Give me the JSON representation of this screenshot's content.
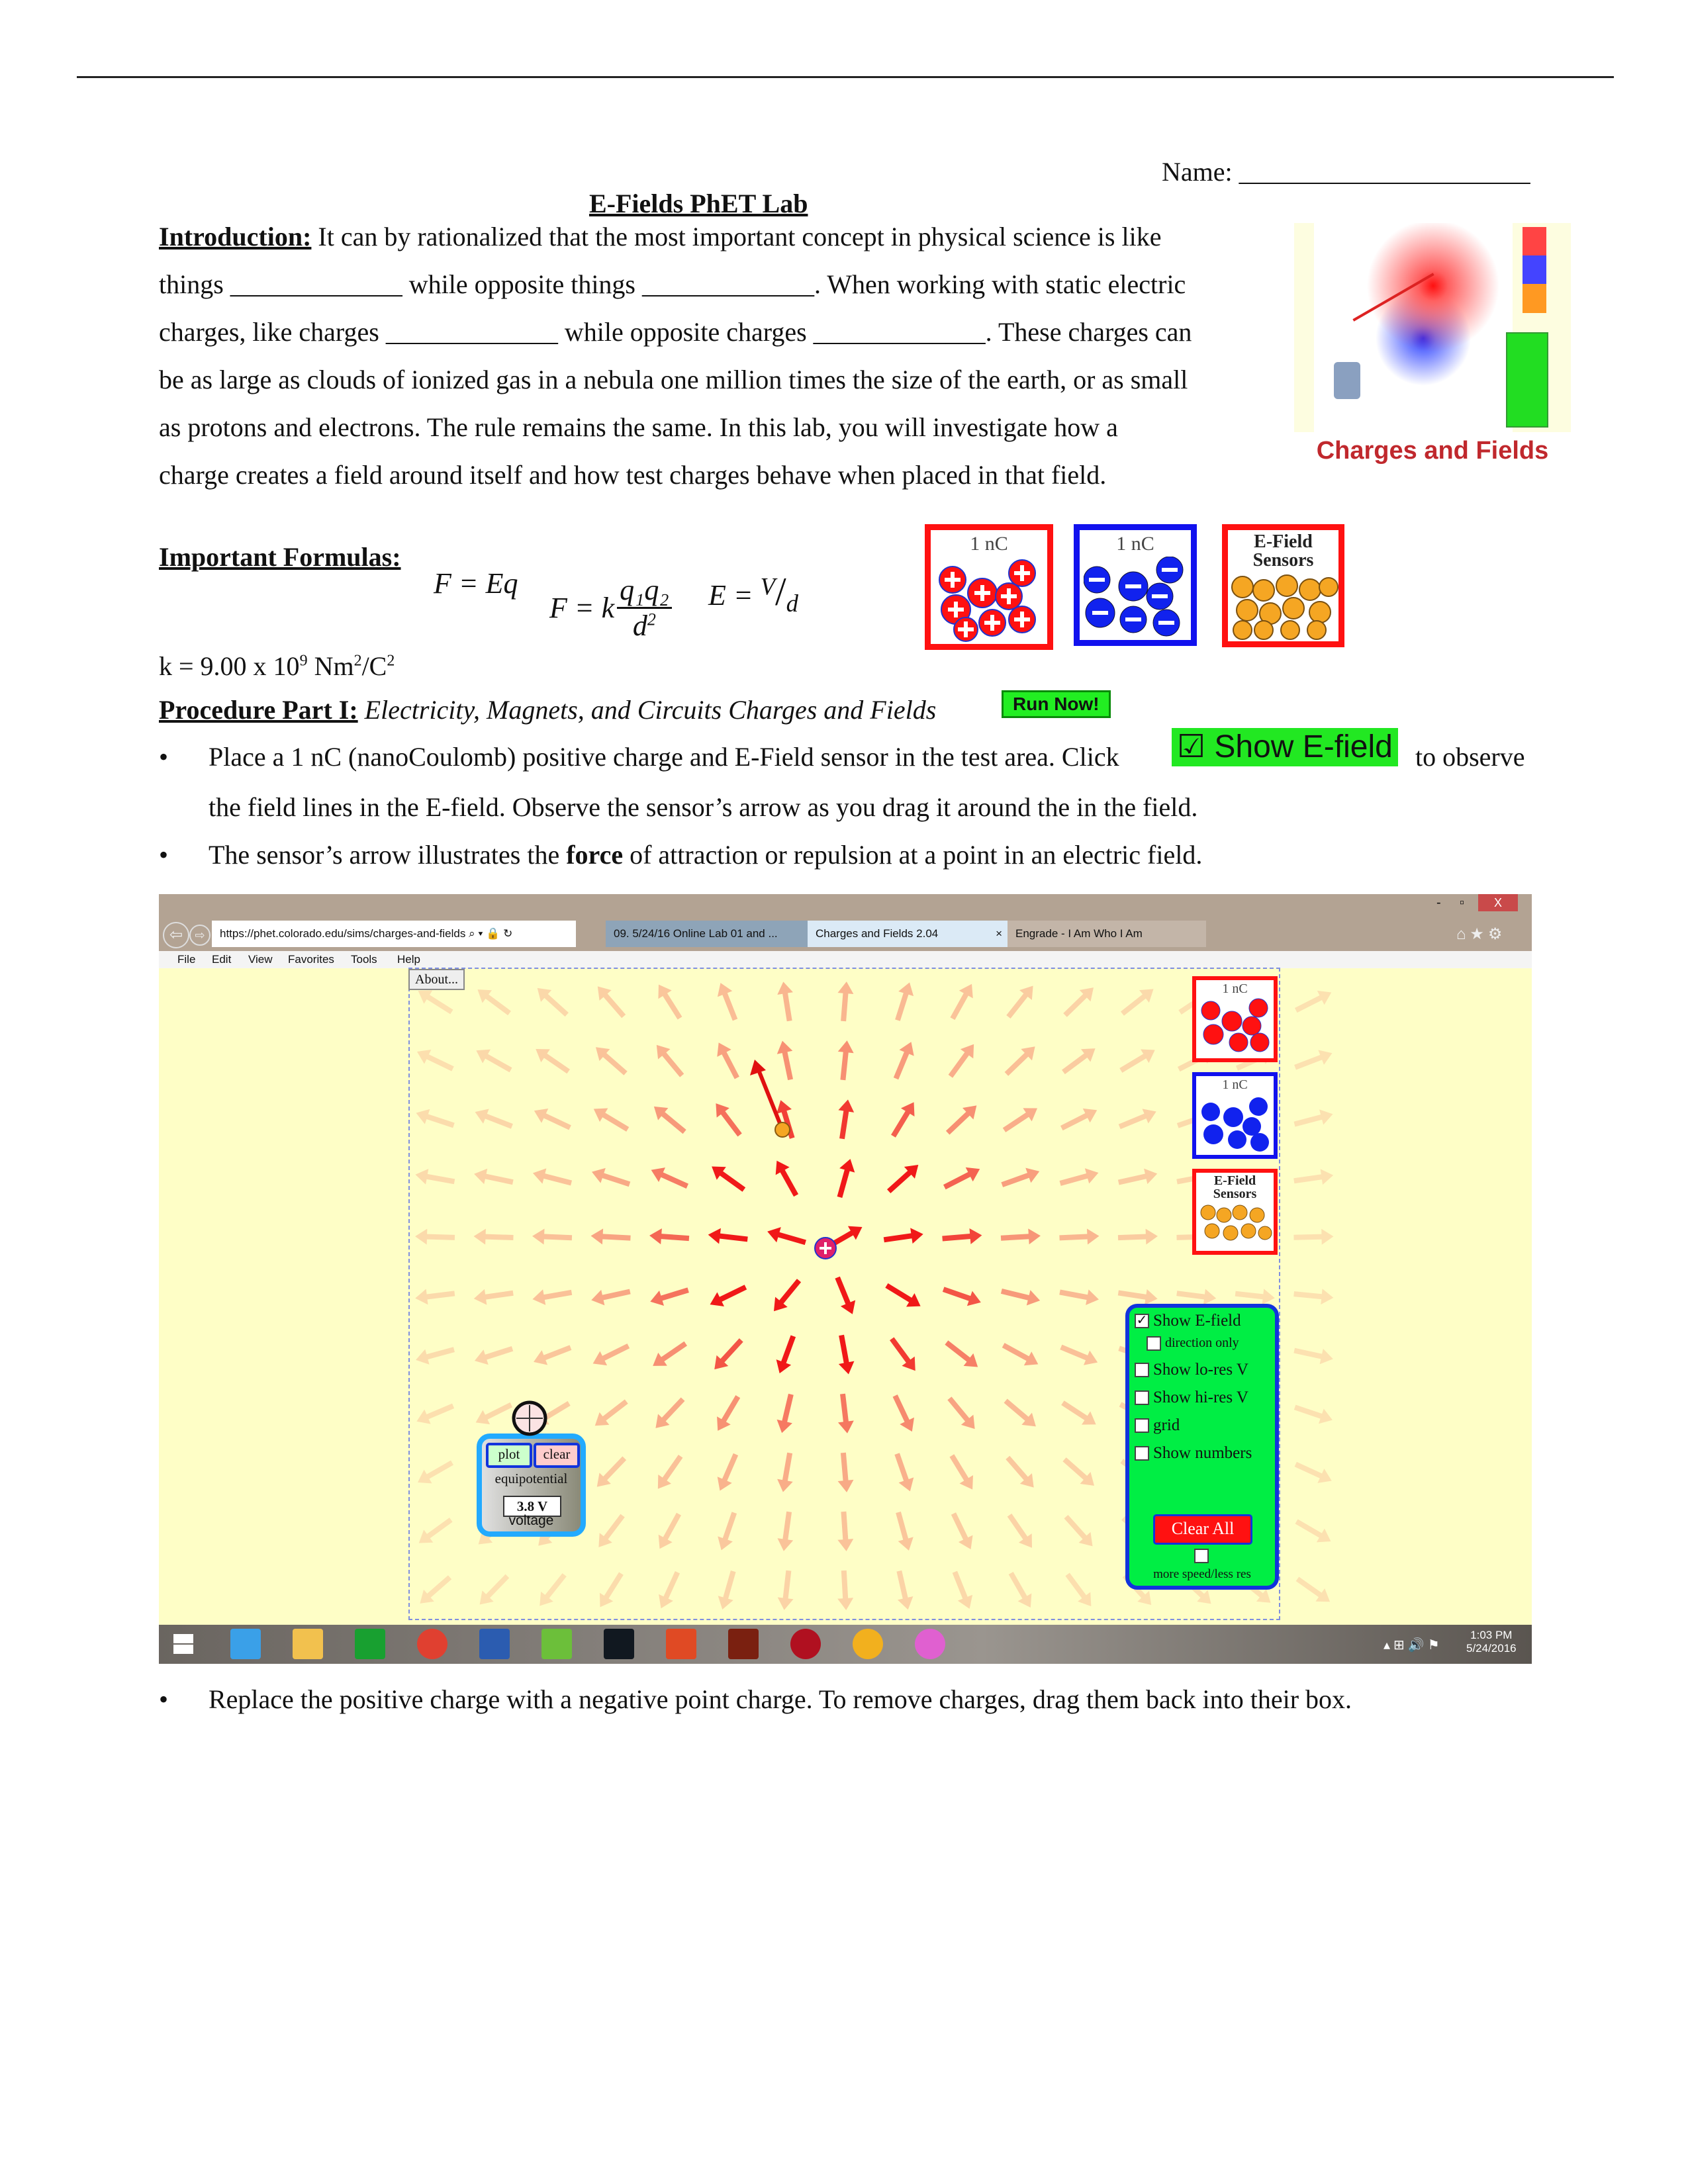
{
  "header": {
    "name_label": "Name: ______________________",
    "title": "E-Fields PhET Lab"
  },
  "intro": {
    "heading": "Introduction:",
    "lines": [
      " It can by rationalized that the most important concept in physical science is like",
      "things _____________ while opposite things _____________.  When working with static electric",
      "charges, like charges _____________ while opposite charges _____________.  These charges can",
      "be as large as clouds of ionized gas in a nebula one million times the size of the earth, or as small",
      "as protons and electrons.  The rule remains the same.  In this lab, you will investigate how a",
      "charge creates a field around itself and how test charges behave when placed in that field."
    ],
    "image_caption": "Charges and Fields"
  },
  "formulas": {
    "heading": "Important Formulas:",
    "f1": "F = Eq",
    "f2_left": "F = k",
    "f2_num": "q₁q₂",
    "f2_den": "d",
    "f2_den_exp": "2",
    "f3_left": "E = ",
    "f3_num": "V",
    "f3_den": "d",
    "k_text": "k = 9.00 x 10",
    "k_exp": "9",
    "k_unit": " Nm",
    "k_unit2": "2",
    "k_unit3": "/C",
    "k_unit4": "2"
  },
  "charge_boxes": [
    {
      "label": "1 nC",
      "symbol": "+",
      "color": "#ff1111"
    },
    {
      "label": "1 nC",
      "symbol": "−",
      "color": "#1111ee"
    },
    {
      "label": "E-Field Sensors",
      "color": "#f5a623"
    }
  ],
  "procedure": {
    "heading": "Procedure Part I:",
    "path_text": " Electricity, Magnets, and Circuits  Charges and Fields",
    "run_button": "Run Now!",
    "bullet1_a": "Place a 1 nC (nanoCoulomb) positive charge and E-Field sensor in the test area.  Click",
    "show_efield_badge": "Show E-field",
    "bullet1_b": "to observe",
    "bullet1_c": "the field lines in the E-field.  Observe the sensor’s arrow as you drag it around the in the field.",
    "bullet2_a": "The sensor’s arrow illustrates the ",
    "bullet2_bold": "force",
    "bullet2_b": " of attraction or repulsion at a point in an electric field.",
    "bullet3": "Replace the positive charge with a negative point charge.  To remove charges, drag them back into their box."
  },
  "browser": {
    "window_controls": [
      "-",
      "▫",
      "X"
    ],
    "url": "https://phet.colorado.edu/sims/charges-and-fields",
    "tabs": [
      {
        "label": "09. 5/24/16 Online Lab 01 and ...",
        "active": false
      },
      {
        "label": "Charges and Fields 2.04",
        "active": true
      },
      {
        "label": "Engrade - I Am Who I Am",
        "active": false
      }
    ],
    "menu": [
      "File",
      "Edit",
      "View",
      "Favorites",
      "Tools",
      "Help"
    ]
  },
  "sim": {
    "about_button": "About...",
    "boxes": [
      {
        "label": "1 nC"
      },
      {
        "label": "1 nC"
      },
      {
        "label": "E-Field Sensors"
      }
    ],
    "controls": {
      "show_efield": {
        "label": "Show E-field",
        "checked": true
      },
      "direction_only": {
        "label": "direction only",
        "checked": false
      },
      "lo_res": {
        "label": "Show lo-res V",
        "checked": false
      },
      "hi_res": {
        "label": "Show hi-res V",
        "checked": false
      },
      "grid": {
        "label": "grid",
        "checked": false
      },
      "numbers": {
        "label": "Show numbers",
        "checked": false
      },
      "clear_all": "Clear All",
      "speed": {
        "label": "more speed/less res",
        "checked": false
      }
    },
    "voltmeter": {
      "plot": "plot",
      "clear": "clear",
      "equipotential": "equipotential",
      "value": "3.8 V",
      "voltage_label": "voltage"
    }
  },
  "taskbar": {
    "icons": [
      "windows-start",
      "internet-explorer",
      "file-explorer",
      "store",
      "chrome",
      "word",
      "hulu",
      "att",
      "office-lens",
      "book",
      "mcafee",
      "norton",
      "itunes"
    ],
    "time": "1:03 PM",
    "date": "5/24/2016"
  }
}
